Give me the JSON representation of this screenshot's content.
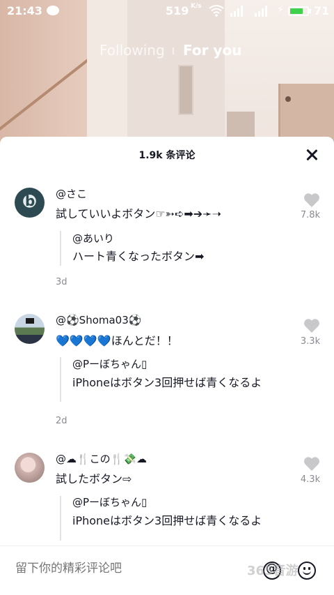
{
  "status_bar": {
    "time": "21:43",
    "network_speed": "519",
    "network_unit": "K/s",
    "battery_percent": "71",
    "battery_level": 0.71,
    "battery_color": "#3fd14b"
  },
  "tabs": {
    "following": "Following",
    "for_you": "For you"
  },
  "comments_sheet": {
    "title": "1.9k 条评论",
    "comments": [
      {
        "username": "@さこ",
        "text": "試していいよボタン☞➳➪➡➔➛➝",
        "likes": "7.8k",
        "reply_username": "@あいり",
        "reply_text": "ハート青くなったボタン➡",
        "date": "3d"
      },
      {
        "username": "@⚽Shoma03⚽",
        "text": "💙💙💙💙ほんとだ！！",
        "likes": "3.3k",
        "reply_username": "@Pーぼちゃん▯",
        "reply_text": "iPhoneはボタン3回押せば青くなるよ",
        "date": "2d"
      },
      {
        "username": "@☁🍴この🍴💸☁",
        "text": "試したボタン⇨",
        "likes": "4.3k",
        "reply_username": "@Pーぼちゃん▯",
        "reply_text": "iPhoneはボタン3回押せば青くなるよ"
      }
    ]
  },
  "input": {
    "placeholder": "留下你的精彩评论吧"
  },
  "watermark": "365音游"
}
